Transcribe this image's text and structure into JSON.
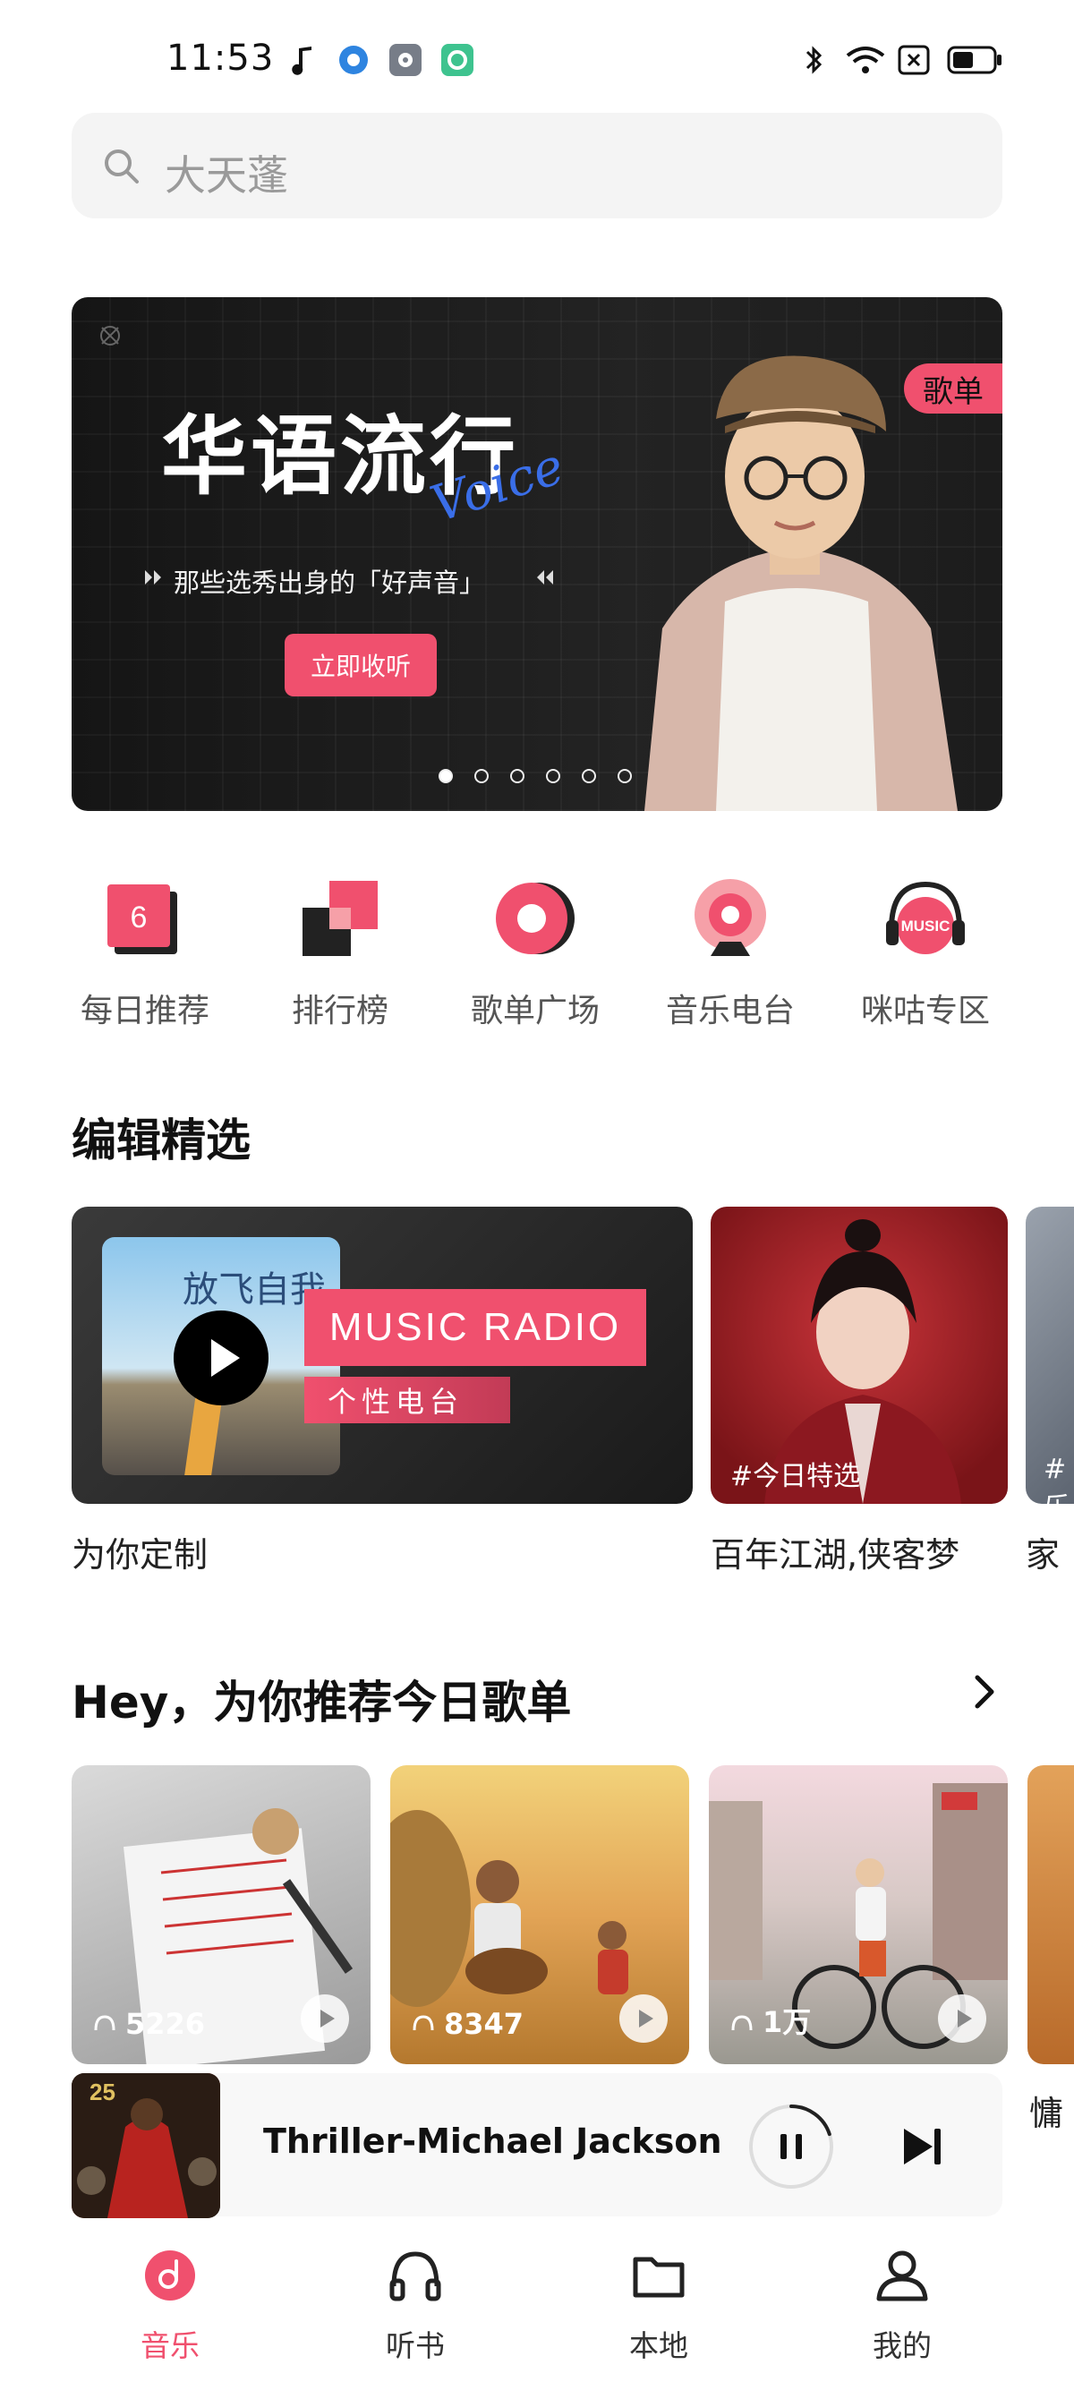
{
  "status_bar": {
    "time": "11:53",
    "left_icons": [
      "music-note-icon",
      "circle-app-icon",
      "settings-app-icon",
      "green-app-icon"
    ],
    "right_icons": [
      "bluetooth-icon",
      "wifi-icon",
      "sim-x-icon",
      "battery-icon"
    ]
  },
  "search": {
    "placeholder": "大天蓬",
    "icon": "search-icon"
  },
  "banner": {
    "title": "华语流行",
    "script_word": "Voice",
    "subtitle": "那些选秀出身的「好声音」",
    "button_label": "立即收听",
    "tag": "歌单",
    "page_count": 6,
    "active_page": 1
  },
  "quick_entries": [
    {
      "label": "每日推荐",
      "icon": "calendar-icon",
      "badge": "6"
    },
    {
      "label": "排行榜",
      "icon": "chart-rank-icon"
    },
    {
      "label": "歌单广场",
      "icon": "playlist-disc-icon"
    },
    {
      "label": "音乐电台",
      "icon": "radio-icon"
    },
    {
      "label": "咪咕专区",
      "icon": "headphones-icon",
      "badge": "MUSIC"
    }
  ],
  "editor_picks": {
    "title": "编辑精选",
    "items": [
      {
        "caption": "为你定制",
        "radio_title": "MUSIC RADIO",
        "radio_sub": "个性电台",
        "cover_text": "放飞自我"
      },
      {
        "caption": "百年江湖,侠客梦",
        "tag": "#今日特选"
      },
      {
        "caption": "家",
        "tag": "#乐"
      }
    ]
  },
  "daily_playlists": {
    "title": "Hey，为你推荐今日歌单",
    "more_icon": "chevron-right-icon",
    "items": [
      {
        "plays": "5226"
      },
      {
        "plays": "8347"
      },
      {
        "plays": "1万"
      },
      {
        "caption_fragment": "慵"
      }
    ]
  },
  "player": {
    "title": "Thriller-Michael Jackson",
    "cover_badge": "25",
    "progress": 0.2,
    "pause_icon": "pause-icon",
    "next_icon": "skip-next-icon"
  },
  "bottom_nav": [
    {
      "label": "音乐",
      "icon": "music-disc-icon",
      "active": true
    },
    {
      "label": "听书",
      "icon": "headphones-icon",
      "active": false
    },
    {
      "label": "本地",
      "icon": "folder-icon",
      "active": false
    },
    {
      "label": "我的",
      "icon": "person-icon",
      "active": false
    }
  ],
  "colors": {
    "accent": "#f0506e",
    "text": "#111111",
    "muted": "#555555"
  }
}
